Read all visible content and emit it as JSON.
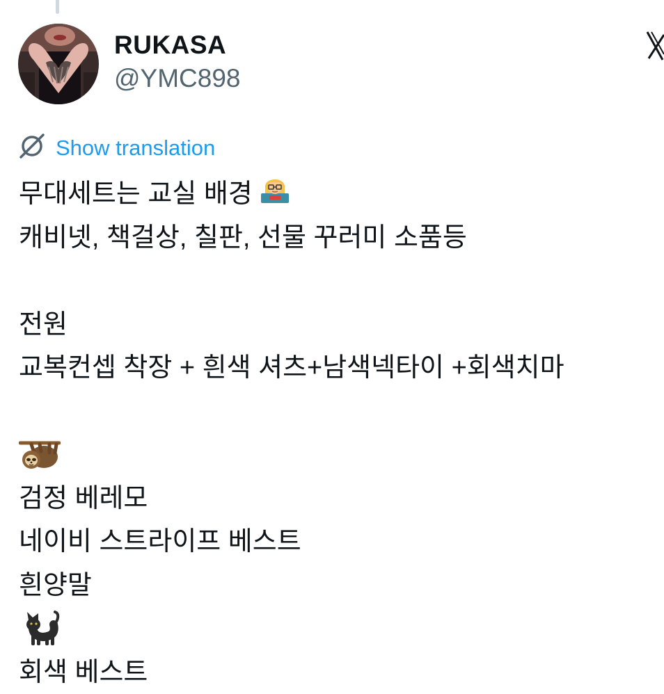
{
  "author": {
    "display_name": "RUKASA",
    "handle": "@YMC898",
    "avatar_icon": "profile-photo-heart-hands"
  },
  "brand": {
    "logo_icon": "x-logo-icon"
  },
  "translation": {
    "label": "Show translation",
    "icon": "translate-globe-icon",
    "color": "#1d9bf0"
  },
  "tweet": {
    "lines": [
      {
        "text": "무대세트는 교실 배경",
        "emoji": "teacher-emoji"
      },
      {
        "text": "캐비넷, 책걸상, 칠판, 선물 꾸러미 소품등"
      },
      {
        "text": ""
      },
      {
        "text": "전원"
      },
      {
        "text": "교복컨셉 착장 + 흰색 셔츠+남색넥타이 +회색치마"
      },
      {
        "text": ""
      },
      {
        "text": "",
        "emoji": "sloth-emoji"
      },
      {
        "text": "검정 베레모"
      },
      {
        "text": "네이비 스트라이프 베스트"
      },
      {
        "text": "흰양말"
      },
      {
        "text": "",
        "emoji": "black-cat-emoji"
      },
      {
        "text": "회색 베스트"
      }
    ]
  },
  "colors": {
    "text": "#0f1419",
    "secondary": "#536471",
    "accent": "#1d9bf0"
  }
}
